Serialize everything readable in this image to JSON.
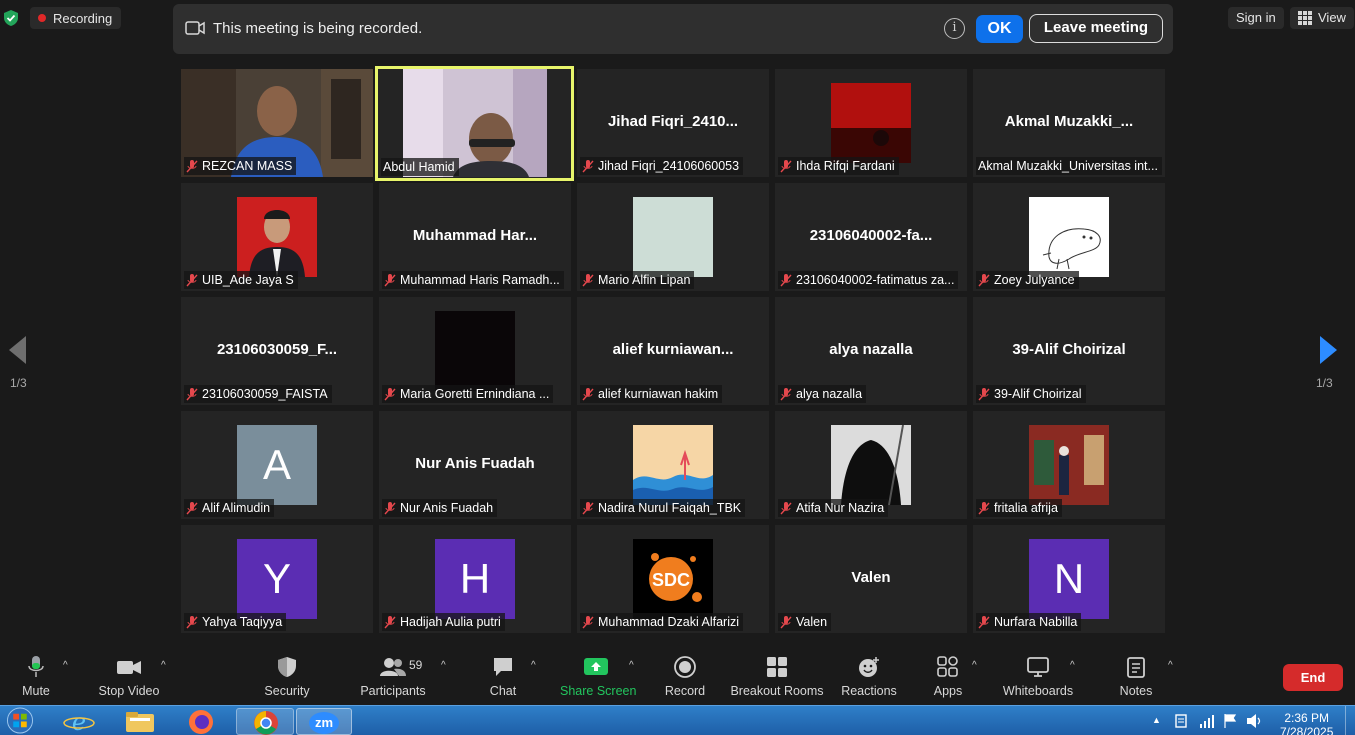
{
  "top_bar": {
    "recording_label": "Recording",
    "banner_message": "This meeting is being recorded.",
    "ok_label": "OK",
    "leave_label": "Leave meeting",
    "sign_in_label": "Sign in",
    "view_label": "View"
  },
  "pagination": {
    "left": "1/3",
    "right": "1/3"
  },
  "tiles": [
    {
      "caption": "REZCAN MASS",
      "bigname": ""
    },
    {
      "caption": "Abdul Hamid",
      "bigname": ""
    },
    {
      "caption": "Jihad Fiqri_24106060053",
      "bigname": "Jihad  Fiqri_2410..."
    },
    {
      "caption": "Ihda Rifqi Fardani",
      "bigname": ""
    },
    {
      "caption": "Akmal Muzakki_Universitas int...",
      "bigname": "Akmal  Muzakki_..."
    },
    {
      "caption": "UIB_Ade Jaya S",
      "bigname": ""
    },
    {
      "caption": "Muhammad Haris Ramadh...",
      "bigname": "Muhammad  Har..."
    },
    {
      "caption": "Mario Alfin Lipan",
      "bigname": ""
    },
    {
      "caption": "23106040002-fatimatus za...",
      "bigname": "23106040002-fa..."
    },
    {
      "caption": "Zoey Julyance",
      "bigname": ""
    },
    {
      "caption": "23106030059_FAISTA",
      "bigname": "23106030059_F..."
    },
    {
      "caption": "Maria Goretti Ernindiana ...",
      "bigname": ""
    },
    {
      "caption": "alief kurniawan hakim",
      "bigname": "alief  kurniawan..."
    },
    {
      "caption": "alya nazalla",
      "bigname": "alya nazalla"
    },
    {
      "caption": "39-Alif Choirizal",
      "bigname": "39-Alif Choirizal"
    },
    {
      "caption": "Alif Alimudin",
      "bigname": "",
      "letter": "A"
    },
    {
      "caption": "Nur Anis Fuadah",
      "bigname": "Nur Anis Fuadah"
    },
    {
      "caption": "Nadira Nurul Faiqah_TBK",
      "bigname": ""
    },
    {
      "caption": "Atifa Nur Nazira",
      "bigname": ""
    },
    {
      "caption": "fritalia afrija",
      "bigname": ""
    },
    {
      "caption": "Yahya Taqiyya",
      "bigname": "",
      "letter": "Y"
    },
    {
      "caption": "Hadijah Aulia putri",
      "bigname": "",
      "letter": "H"
    },
    {
      "caption": "Muhammad Dzaki Alfarizi",
      "bigname": "",
      "logo_text": "SDC"
    },
    {
      "caption": "Valen",
      "bigname": "Valen"
    },
    {
      "caption": "Nurfara Nabilla",
      "bigname": "",
      "letter": "N"
    }
  ],
  "toolbar": {
    "mute": "Mute",
    "stop_video": "Stop Video",
    "security": "Security",
    "participants": "Participants",
    "participants_count": "59",
    "chat": "Chat",
    "share_screen": "Share Screen",
    "record": "Record",
    "breakout_rooms": "Breakout Rooms",
    "reactions": "Reactions",
    "apps": "Apps",
    "whiteboards": "Whiteboards",
    "notes": "Notes",
    "end": "End"
  },
  "taskbar": {
    "zoom_label": "zm",
    "time": "2:36 PM",
    "date": "7/28/2025"
  },
  "colors": {
    "accent_blue": "#0e71eb",
    "share_green": "#22c55e",
    "end_red": "#d52b2b",
    "active_speaker": "#e8f56b",
    "avatar_purple": "#5b2db3",
    "avatar_gray": "#7a8e9b"
  }
}
